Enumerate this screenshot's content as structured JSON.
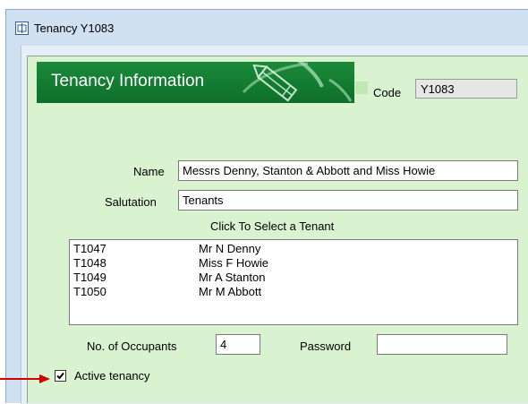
{
  "window": {
    "title": "Tenancy Y1083",
    "icon": "app-window-icon"
  },
  "banner": {
    "title": "Tenancy Information",
    "icon": "pencil-icon",
    "color": "#1a8a3a"
  },
  "code": {
    "label": "Code",
    "value": "Y1083"
  },
  "form": {
    "name_label": "Name",
    "name_value": "Messrs Denny, Stanton & Abbott and Miss Howie",
    "salutation_label": "Salutation",
    "salutation_value": "Tenants",
    "select_caption": "Click To Select a Tenant",
    "occupants_label": "No. of Occupants",
    "occupants_value": "4",
    "password_label": "Password",
    "password_value": ""
  },
  "tenants": [
    {
      "id": "T1047",
      "name": "Mr N Denny"
    },
    {
      "id": "T1048",
      "name": "Miss F Howie"
    },
    {
      "id": "T1049",
      "name": "Mr A Stanton"
    },
    {
      "id": "T1050",
      "name": "Mr M Abbott"
    }
  ],
  "active": {
    "label": "Active tenancy",
    "checked": true
  },
  "colors": {
    "panel_bg": "#d9f2d0",
    "annotation_arrow": "#d00000"
  }
}
